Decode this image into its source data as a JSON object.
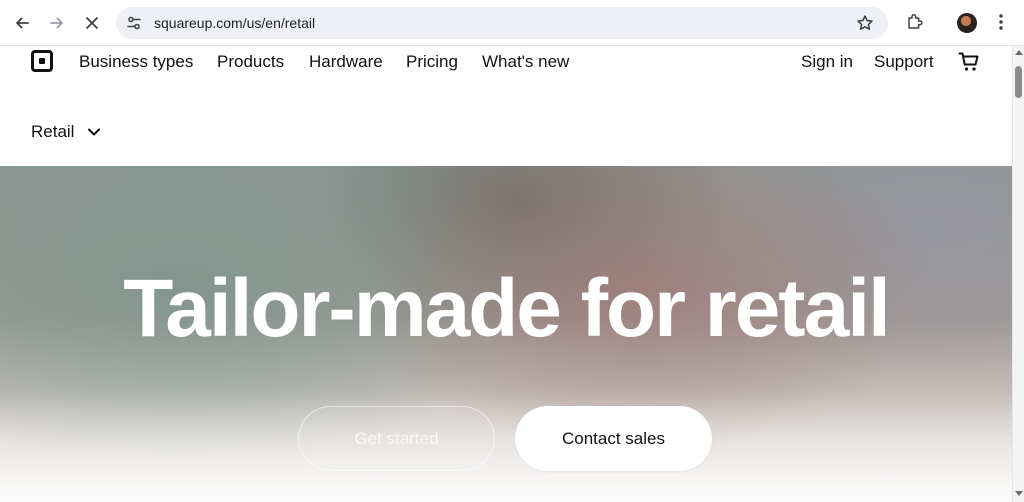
{
  "browser": {
    "url": "squareup.com/us/en/retail"
  },
  "nav": {
    "items": [
      "Business types",
      "Products",
      "Hardware",
      "Pricing",
      "What's new"
    ],
    "sign_in": "Sign in",
    "support": "Support",
    "subnav_label": "Retail"
  },
  "hero": {
    "title": "Tailor-made for retail",
    "get_started": "Get started",
    "contact_sales": "Contact sales"
  },
  "icons": {
    "back": "arrow-left-icon",
    "forward": "arrow-right-icon",
    "stop": "close-icon",
    "site_info": "tune-icon",
    "bookmark": "star-icon",
    "extensions": "puzzle-icon",
    "menu": "kebab-icon",
    "logo": "square-logo-icon",
    "cart": "cart-icon",
    "chevron": "chevron-down-icon"
  }
}
